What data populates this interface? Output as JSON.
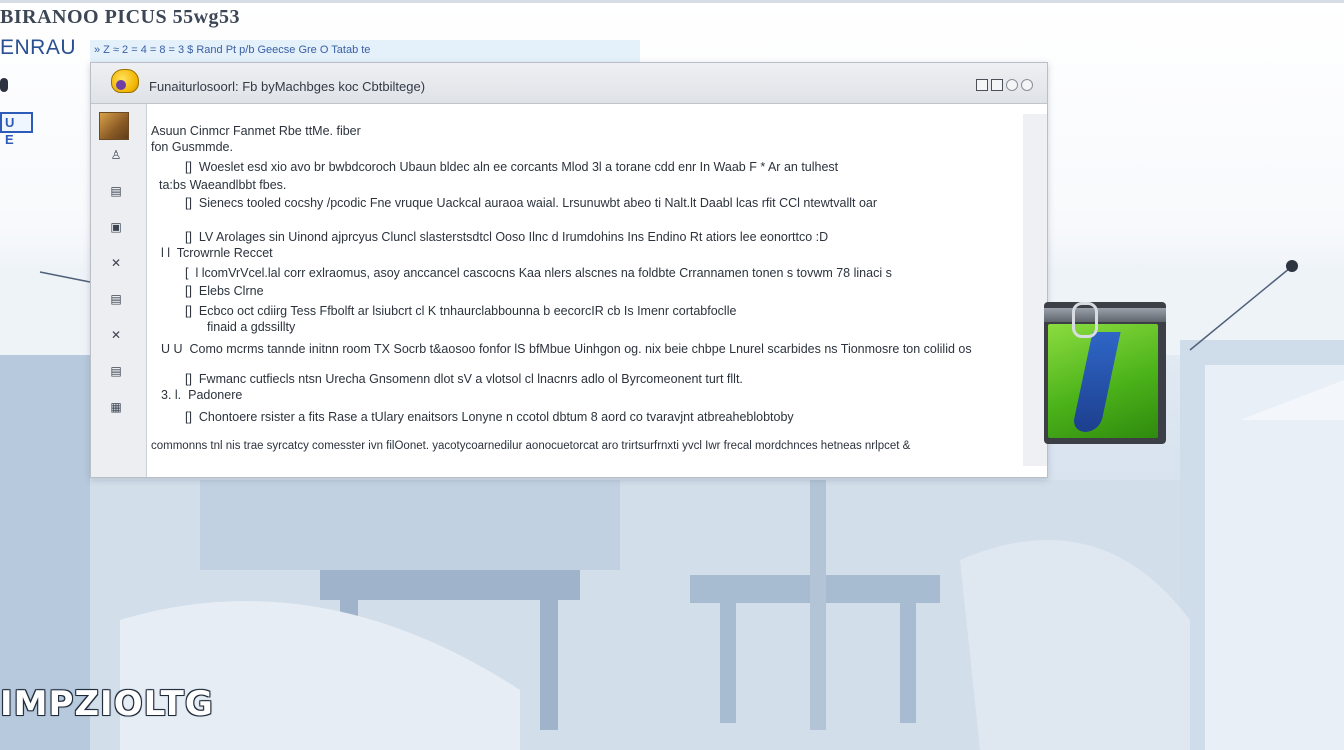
{
  "header": {
    "title": "BIRANOO PICUS 55wg53",
    "subtitle": "ENRAU",
    "strip_text": "» Z ≈ 2 = 4 = 8 = 3 $ Rand Pt p/b Geecse Gre  O Tatab te",
    "badge": "U E"
  },
  "dialog": {
    "title": "Funaiturlosoorl: Fb byMachbges koc Cbtbiltege)",
    "side_items": [
      {
        "icon": "person-icon",
        "glyph": "♙"
      },
      {
        "icon": "card-icon",
        "glyph": "▤"
      },
      {
        "icon": "screen-icon",
        "glyph": "▣"
      },
      {
        "icon": "expand-icon",
        "glyph": "✕"
      },
      {
        "icon": "panel-icon",
        "glyph": "▤"
      },
      {
        "icon": "close-icon",
        "glyph": "✕"
      },
      {
        "icon": "list-icon",
        "glyph": "▤"
      },
      {
        "icon": "grid-icon",
        "glyph": "▦"
      }
    ],
    "lines": {
      "l1": "Asuun Cinmcr Fanmet Rbe ttMe. fiber",
      "l2": "fon Gusmmde.",
      "l3": "Woeslet esd xio avo br bwbdcoroch Ubaun bldec aln ee corcants Mlod     3l a torane  cdd enr In Waab  F *  Ar an tulhest",
      "l4": "ta:bs Waeandlbbt fbes.",
      "l5": "Sienecs tooled cocshy /pcodic Fne vruque Uackcal auraoa waial. Lrsunuwbt abeo ti Nalt.lt Daabl lcas rfit CCl  ntewtvallt oar",
      "l6": "LV Arolages sin Uinond ajprcyus Cluncl slasterstsdtcl Ooso Ilnc d Irumdohins  Ins Endino  Rt atiors lee eonorttco :D",
      "l7": "Tcrowrnle  Reccet",
      "l8": "l  lcomVrVcel.lal corr exlraomus, asoy anccancel  cascocns Kaa nlers alscnes na foldbte  Crrannamen tonen s  tovwm  78 linaci s",
      "l9": "Elebs  Clrne",
      "l10": "Ecbco oct cdiirg Tess Ffbolft ar lsiubcrt cl  K tnhaurclabbounna b eecorcIR cb Is Imenr cortabfoclle",
      "l11": "finaid a gdssillty",
      "l12": "Como mcrms tannde initnn room TX Socrb t&aosoo fonfor lS bfMbue Uinhgon og. nix  beie chbpe  Lnurel scarbides ns  Tionmosre ton colilid os",
      "l13": "Fwmanc cutfiecls ntsn Urecha  Gnsomenn dlot  sV a vlotsol cl  lnacnrs adlo ol  Byrcomeonent turt fllt.",
      "l14": "Padonere",
      "l15": "Chontoere rsister a fits Rase a tUlary enaitsors Lonyne n ccotol dbtum 8 aord  co tvaravjnt atbreaheblobtoby",
      "l16": "commonns tnl nis trae syrcatcy comesster ivn  filOonet. yacotycoarnedilur aonocuetorcat aro trirtsurfrnxti yvcl Iwr frecal mordchnces hetneas nrlpcet &"
    },
    "line_marks": {
      "l3": "[]",
      "l5": "[]",
      "l6": "[]",
      "l7": "l  l",
      "l8": "[",
      "l9": "[]",
      "l10": "[]",
      "l12": "U U",
      "l13": "[]",
      "l14": "3.  l.",
      "l15": "[]"
    }
  },
  "brand": {
    "text": "IMPZIOLTG"
  },
  "colors": {
    "accent": "#2b4f93",
    "folder_green": "#4cb31a",
    "tie_blue": "#2f66c7",
    "bg_blue": "#c9d7e6"
  }
}
